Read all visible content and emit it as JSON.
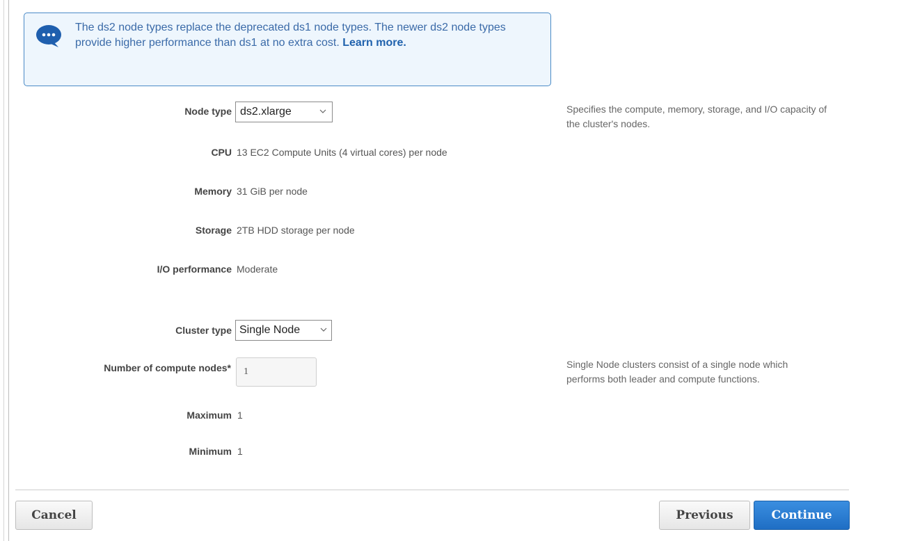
{
  "info_banner": {
    "icon": "speech-bubble-icon",
    "text": "The ds2 node types replace the deprecated ds1 node types. The newer ds2 node types provide higher performance than ds1 at no extra cost.",
    "link_label": "Learn more."
  },
  "node_config": {
    "node_type": {
      "label": "Node type",
      "selected": "ds2.xlarge",
      "help": "Specifies the compute, memory, storage, and I/O capacity of the cluster's nodes."
    },
    "cpu": {
      "label": "CPU",
      "value": "13 EC2 Compute Units (4 virtual cores) per node"
    },
    "memory": {
      "label": "Memory",
      "value": "31 GiB per node"
    },
    "storage": {
      "label": "Storage",
      "value": "2TB HDD storage per node"
    },
    "io_performance": {
      "label": "I/O performance",
      "value": "Moderate"
    }
  },
  "cluster_config": {
    "cluster_type": {
      "label": "Cluster type",
      "selected": "Single Node"
    },
    "compute_nodes": {
      "label": "Number of compute nodes*",
      "value": "1",
      "help": "Single Node clusters consist of a single node which performs both leader and compute functions."
    },
    "maximum": {
      "label": "Maximum",
      "value": "1"
    },
    "minimum": {
      "label": "Minimum",
      "value": "1"
    }
  },
  "footer": {
    "cancel_label": "Cancel",
    "previous_label": "Previous",
    "continue_label": "Continue"
  },
  "colors": {
    "primary": "#1f6ec4",
    "info_bg": "#eef6fd",
    "info_border": "#4a8ac6"
  }
}
